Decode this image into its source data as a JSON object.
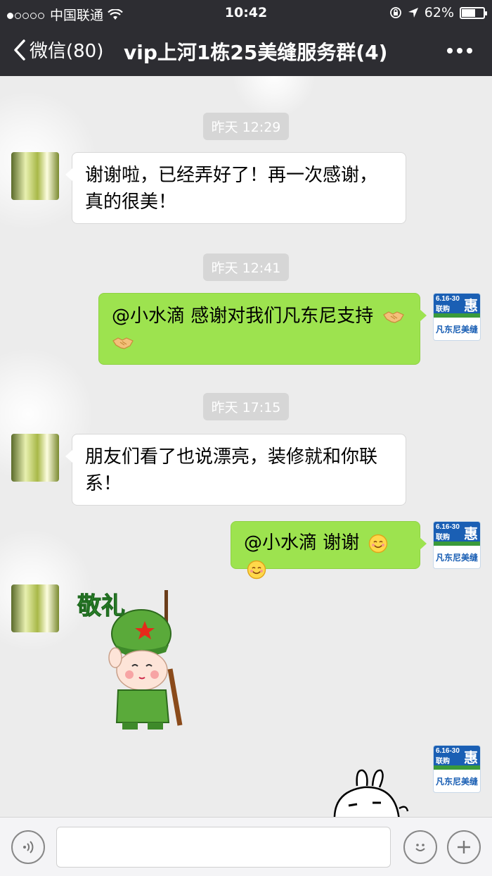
{
  "status_bar": {
    "carrier": "中国联通",
    "time": "10:42",
    "battery": "62%",
    "battery_level": 0.62
  },
  "nav": {
    "back_label": "微信(80)",
    "title": "vip上河1栋25美缝服务群(4)"
  },
  "messages": [
    {
      "type": "time",
      "text": "昨天 12:29"
    },
    {
      "type": "in",
      "lines": [
        "谢谢啦，已经弄好了！再一次感谢，",
        "真的很美！"
      ]
    },
    {
      "type": "time",
      "text": "昨天 12:41"
    },
    {
      "type": "out",
      "text": "@小水滴 感谢对我们凡东尼支持",
      "emoji": "handshake-icon"
    },
    {
      "type": "time",
      "text": "昨天 17:15"
    },
    {
      "type": "in",
      "lines": [
        "朋友们看了也说漂亮，装修就和你联",
        "系！"
      ]
    },
    {
      "type": "out",
      "text": "@小水滴 谢谢",
      "emoji": "smile-icon"
    },
    {
      "type": "sticker",
      "text": "敬礼"
    }
  ],
  "avatar_right": {
    "date": "6.16-30",
    "promo": "联购",
    "promo_big": "惠",
    "brand": "凡东尼美缝"
  },
  "colors": {
    "bar": "#2d2d32",
    "bubble_out": "#9de34f",
    "bubble_in": "#ffffff",
    "chat_bg": "#ececec"
  }
}
